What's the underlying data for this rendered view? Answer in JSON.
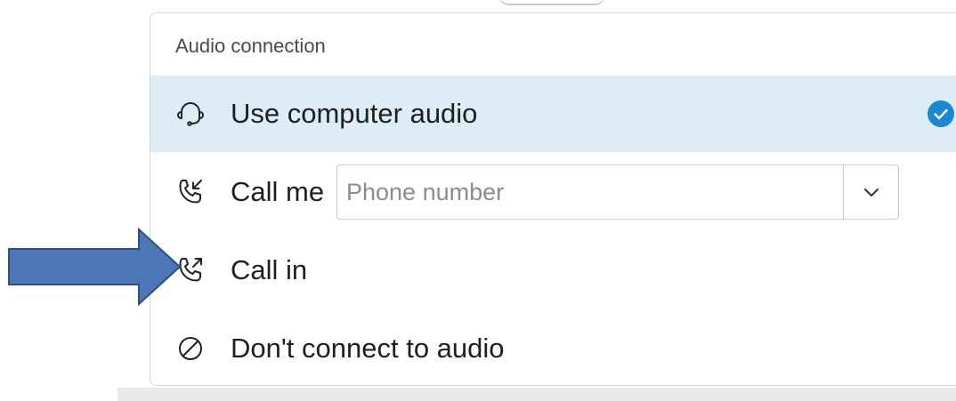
{
  "panel": {
    "title": "Audio connection"
  },
  "options": [
    {
      "label": "Use computer audio",
      "icon": "headset-icon",
      "selected": true
    },
    {
      "label": "Call me",
      "icon": "phone-incoming-icon",
      "selected": false
    },
    {
      "label": "Call in",
      "icon": "phone-outgoing-icon",
      "selected": false
    },
    {
      "label": "Don't connect to audio",
      "icon": "no-audio-icon",
      "selected": false
    }
  ],
  "phone": {
    "placeholder": "Phone number",
    "value": ""
  },
  "colors": {
    "selected_bg": "#dcedf7",
    "check": "#1b87d3",
    "arrow_fill": "#4c77b6",
    "arrow_stroke": "#2e4f80"
  }
}
